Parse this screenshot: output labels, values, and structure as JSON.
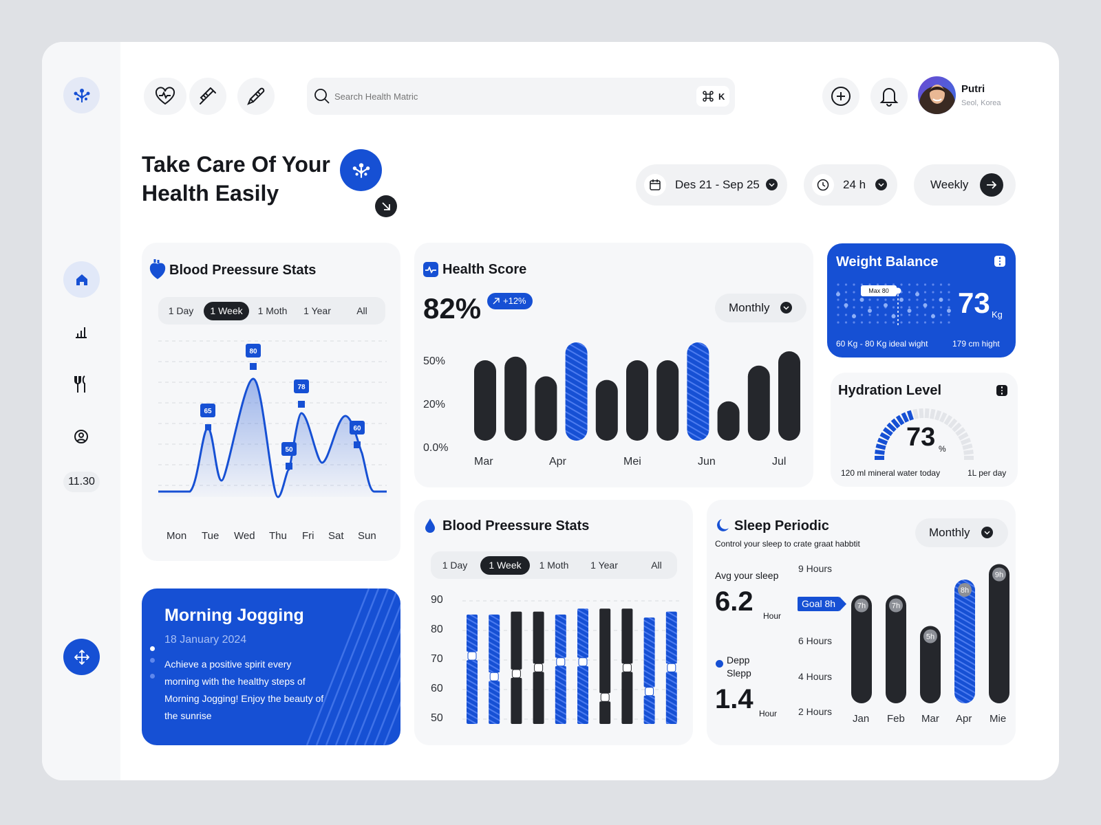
{
  "header": {
    "search": {
      "placeholder": "Search Health Matric",
      "shortcut_key": "K"
    },
    "user": {
      "name": "Putri",
      "location": "Seol, Korea"
    }
  },
  "sidebar": {
    "time": "11.30"
  },
  "hero": {
    "title_line1": "Take Care Of Your",
    "title_line2": "Health Easily"
  },
  "filters": {
    "date_range": "Des 21 - Sep 25",
    "duration": "24 h",
    "period": "Weekly"
  },
  "bp_line": {
    "title": "Blood Preessure Stats",
    "tabs": [
      "1 Day",
      "1 Week",
      "1 Moth",
      "1 Year",
      "All"
    ],
    "active_tab": "1 Week",
    "chart_data": {
      "type": "line",
      "categories": [
        "Mon",
        "Tue",
        "Wed",
        "Thu",
        "Fri",
        "Sat",
        "Sun"
      ],
      "data_labels": [
        "65",
        "80",
        "50",
        "78",
        "60"
      ],
      "series_color": "#1650d4"
    }
  },
  "health_score": {
    "title": "Health Score",
    "value": "82%",
    "change": "+12%",
    "dropdown": "Monthly",
    "chart_data": {
      "type": "bar",
      "y_ticks": [
        "50%",
        "20%",
        "0.0%"
      ],
      "x_labels": [
        "Mar",
        "Apr",
        "Mei",
        "Jun",
        "Jul"
      ],
      "values": [
        45,
        47,
        36,
        55,
        34,
        45,
        45,
        55,
        22,
        42,
        50
      ],
      "highlight_index": [
        3,
        7
      ],
      "colors": {
        "dark": "#25272c",
        "highlight": "#1650d4"
      }
    }
  },
  "weight": {
    "title": "Weight Balance",
    "value": "73",
    "unit": "Kg",
    "max_label": "Max 80",
    "ideal": "60 Kg - 80 Kg ideal wight",
    "height": "179 cm hight",
    "card_color": "#1650d4"
  },
  "hydration": {
    "title": "Hydration Level",
    "value": "73",
    "unit": "%",
    "note_left": "120 ml mineral water today",
    "note_right": "1L per day",
    "gauge_fraction": 0.4
  },
  "jogging": {
    "title": "Morning Jogging",
    "date": "18 January 2024",
    "lines": [
      "Achieve a positive spirit every",
      "morning with the healthy steps of",
      "Morning Jogging! Enjoy the beauty of",
      "the sunrise"
    ]
  },
  "bp_bars": {
    "title": "Blood Preessure Stats",
    "tabs": [
      "1 Day",
      "1 Week",
      "1 Moth",
      "1 Year",
      "All"
    ],
    "active_tab": "1 Week",
    "chart_data": {
      "type": "bar",
      "y_ticks": [
        "90",
        "80",
        "70",
        "60",
        "50"
      ],
      "ylim": [
        50,
        90
      ],
      "bars": [
        {
          "color": "blue",
          "top": 87,
          "split": 73,
          "bottom": 50
        },
        {
          "color": "blue",
          "top": 87,
          "split": 66,
          "bottom": 50
        },
        {
          "color": "dark",
          "top": 88,
          "split": 67,
          "bottom": 50
        },
        {
          "color": "dark",
          "top": 88,
          "split": 69,
          "bottom": 50
        },
        {
          "color": "blue",
          "top": 87,
          "split": 71,
          "bottom": 50
        },
        {
          "color": "blue",
          "top": 89,
          "split": 71,
          "bottom": 50
        },
        {
          "color": "dark",
          "top": 89,
          "split": 59,
          "bottom": 50
        },
        {
          "color": "dark",
          "top": 89,
          "split": 69,
          "bottom": 50
        },
        {
          "color": "blue",
          "top": 86,
          "split": 61,
          "bottom": 50
        },
        {
          "color": "blue",
          "top": 88,
          "split": 69,
          "bottom": 50
        }
      ]
    }
  },
  "sleep": {
    "title": "Sleep Periodic",
    "subtitle": "Control your sleep to crate graat habbtit",
    "dropdown": "Monthly",
    "avg_label": "Avg your sleep",
    "avg_value": "6.2",
    "avg_unit": "Hour",
    "deep_label_1": "Depp",
    "deep_label_2": "Slepp",
    "deep_value": "1.4",
    "deep_unit": "Hour",
    "goal": "Goal 8h",
    "chart_data": {
      "type": "bar",
      "y_labels": [
        "9 Hours",
        "6 Hours",
        "4 Hours",
        "2 Hours"
      ],
      "categories": [
        "Jan",
        "Feb",
        "Mar",
        "Apr",
        "Mie"
      ],
      "values": [
        7,
        7,
        5,
        8,
        9
      ],
      "value_labels": [
        "7h",
        "7h",
        "5h",
        "8h",
        "9h"
      ],
      "highlight": "Apr"
    }
  }
}
